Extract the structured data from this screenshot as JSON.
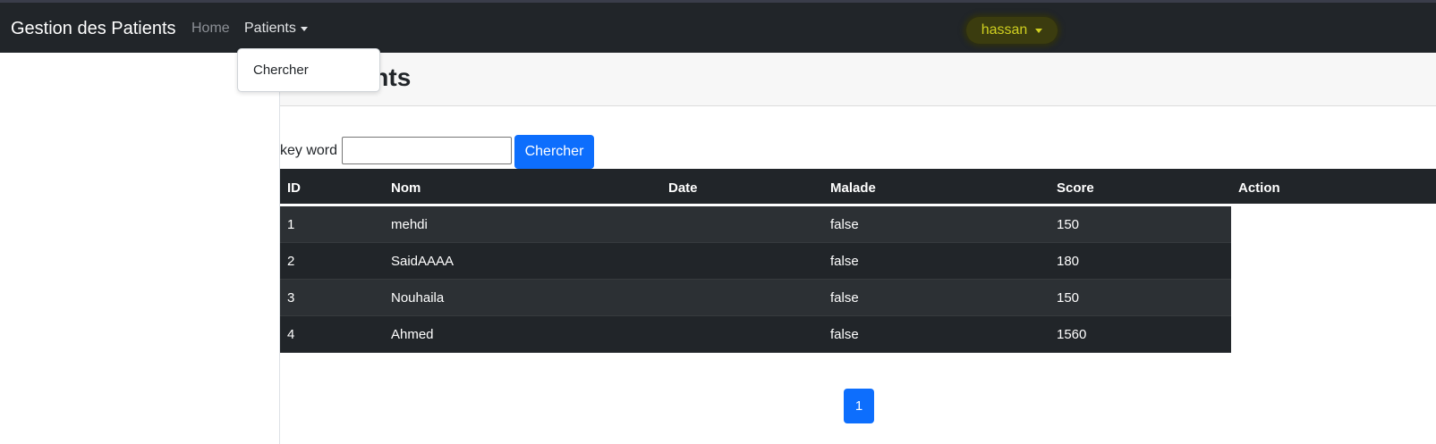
{
  "navbar": {
    "brand": "Gestion des Patients",
    "home": "Home",
    "patients": "Patients",
    "user": "hassan"
  },
  "dropdown": {
    "items": [
      {
        "label": "Chercher"
      }
    ]
  },
  "page": {
    "title": "Liste des patients",
    "visible_title": "es patients"
  },
  "search": {
    "label": "key word",
    "value": "",
    "button": "Chercher"
  },
  "table": {
    "columns": [
      "ID",
      "Nom",
      "Date",
      "Malade",
      "Score",
      "Action"
    ],
    "rows": [
      {
        "id": "1",
        "nom": "mehdi",
        "date": "",
        "malade": "false",
        "score": "150"
      },
      {
        "id": "2",
        "nom": "SaidAAAA",
        "date": "",
        "malade": "false",
        "score": "180"
      },
      {
        "id": "3",
        "nom": "Nouhaila",
        "date": "",
        "malade": "false",
        "score": "150"
      },
      {
        "id": "4",
        "nom": "Ahmed",
        "date": "",
        "malade": "false",
        "score": "1560"
      }
    ]
  },
  "pagination": {
    "pages": [
      "1"
    ],
    "current": "1"
  },
  "colors": {
    "navbar": "#212529",
    "primary": "#0d6efd",
    "user_highlight": "#cfcf20"
  }
}
